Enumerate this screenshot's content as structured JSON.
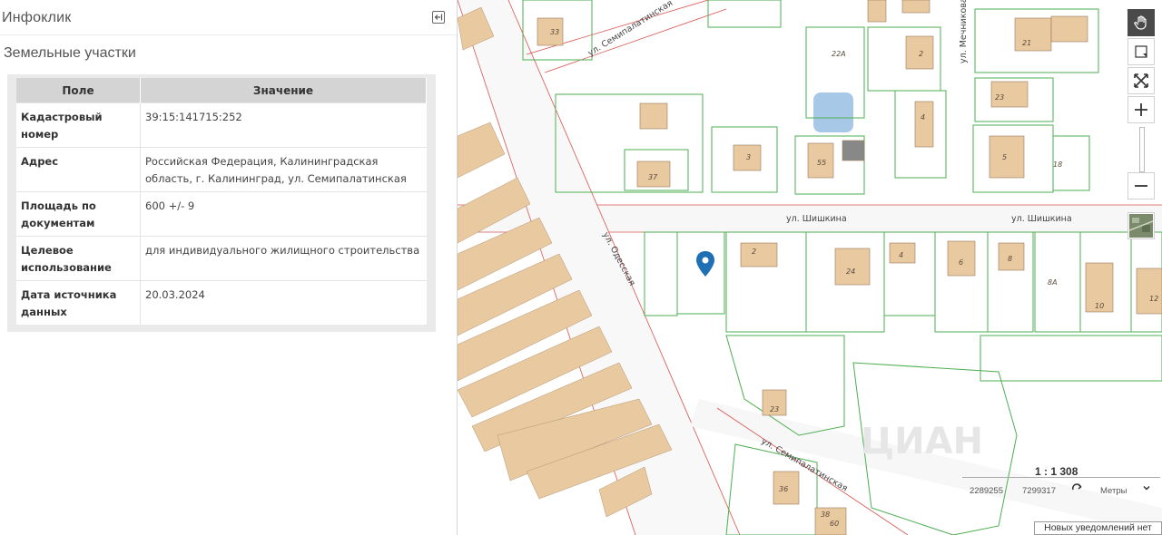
{
  "panel": {
    "title": "Инфоклик",
    "section_title": "Земельные участки",
    "table": {
      "headers": [
        "Поле",
        "Значение"
      ],
      "rows": [
        {
          "field": "Кадастровый номер",
          "value": "39:15:141715:252"
        },
        {
          "field": "Адрес",
          "value": "Российская Федерация, Калининградская область, г. Калининград, ул. Семипалатинская"
        },
        {
          "field": "Площадь по документам",
          "value": "600 +/- 9"
        },
        {
          "field": "Целевое использование",
          "value": "для индивидуального жилищного строительства"
        },
        {
          "field": "Дата источника данных",
          "value": "20.03.2024"
        }
      ]
    }
  },
  "map": {
    "streets": [
      "ул. Семипалатинская",
      "ул. Мечникова",
      "ул. Шишкина",
      "ул. Шишкина",
      "ул. Одесская",
      "ул. Семипалатинская"
    ],
    "building_numbers": [
      "33",
      "22А",
      "2",
      "21",
      "23",
      "4",
      "37",
      "3",
      "55",
      "5",
      "18",
      "2",
      "24",
      "4",
      "6",
      "8",
      "8А",
      "10",
      "12",
      "23",
      "36",
      "38",
      "60"
    ],
    "scale": "1 : 1 308",
    "coord_x": "2289255",
    "coord_y": "7299317",
    "units": "Метры",
    "watermark": "ЦИАН",
    "colors": {
      "building": "#e8c9a0",
      "parcel_border": "#4caf50",
      "road_border": "#d9534f",
      "water": "#a8c8e8",
      "marker": "#1f6fb5"
    }
  },
  "tools": [
    "pan-hand-icon",
    "select-area-icon",
    "fullscreen-icon",
    "zoom-in-icon",
    "zoom-out-icon",
    "layers-icon"
  ],
  "notification": "Новых уведомлений нет"
}
